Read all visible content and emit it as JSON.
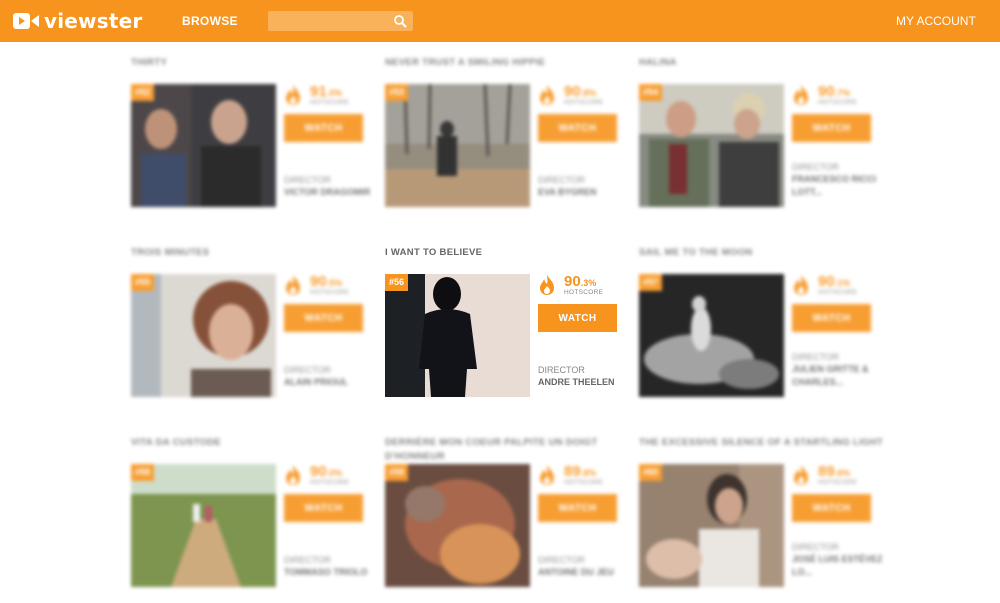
{
  "header": {
    "logo_text": "viewster",
    "browse": "BROWSE",
    "search_placeholder": "",
    "account": "MY ACCOUNT",
    "accent": "#f7941d"
  },
  "score_label": "HOTSCORE",
  "watch_label": "WATCH",
  "director_label": "DIRECTOR",
  "films": [
    {
      "title": "THIRTY",
      "rank": "#52",
      "score": "91",
      "score_dec": ".0%",
      "director": "VICTOR DRAGOMIR"
    },
    {
      "title": "NEVER TRUST A SMILING HIPPIE",
      "rank": "#53",
      "score": "90",
      "score_dec": ".8%",
      "director": "EVA BYGREN"
    },
    {
      "title": "HALINA",
      "rank": "#54",
      "score": "90",
      "score_dec": ".7%",
      "director": "FRANCESCO RICCI LOTT..."
    },
    {
      "title": "TROIS MINUTES",
      "rank": "#55",
      "score": "90",
      "score_dec": ".5%",
      "director": "ALAIN PRIOUL"
    },
    {
      "title": "I WANT TO BELIEVE",
      "rank": "#56",
      "score": "90",
      "score_dec": ".3%",
      "director": "ANDRE THEELEN"
    },
    {
      "title": "SAIL ME TO THE MOON",
      "rank": "#57",
      "score": "90",
      "score_dec": ".1%",
      "director": "JULIEN GRITTE & CHARLES..."
    },
    {
      "title": "VITA DA CUSTODE",
      "rank": "#58",
      "score": "90",
      "score_dec": ".0%",
      "director": "TOMMASO TRIOLO"
    },
    {
      "title": "DERRIÈRE MON COEUR PALPITE UN DOIGT D'HONNEUR",
      "rank": "#59",
      "score": "89",
      "score_dec": ".8%",
      "director": "ANTOINE DU JEU"
    },
    {
      "title": "THE EXCESSIVE SILENCE OF A STARTLING LIGHT",
      "rank": "#60",
      "score": "89",
      "score_dec": ".6%",
      "director": "JOSÉ LUIS ESTÉVEZ LO..."
    }
  ]
}
